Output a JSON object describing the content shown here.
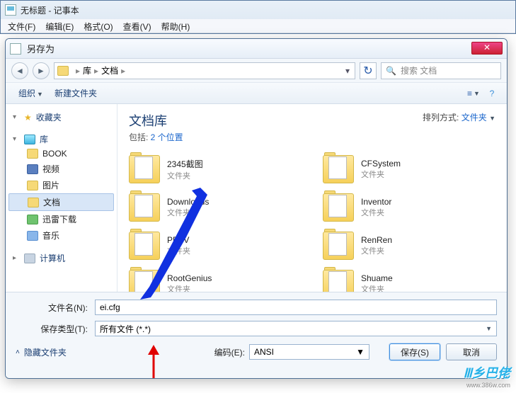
{
  "notepad": {
    "title": "无标题 - 记事本",
    "menu": {
      "file": "文件(F)",
      "edit": "编辑(E)",
      "format": "格式(O)",
      "view": "查看(V)",
      "help": "帮助(H)"
    }
  },
  "dialog": {
    "title": "另存为",
    "close_glyph": "✕",
    "breadcrumb": {
      "root": "库",
      "current": "文档"
    },
    "search_placeholder": "搜索 文档",
    "toolbar": {
      "organize": "组织",
      "new_folder": "新建文件夹"
    },
    "sidebar": {
      "favorites": "收藏夹",
      "libraries": "库",
      "items": [
        {
          "label": "BOOK"
        },
        {
          "label": "视频"
        },
        {
          "label": "图片"
        },
        {
          "label": "文档"
        },
        {
          "label": "迅雷下载"
        },
        {
          "label": "音乐"
        }
      ],
      "computer": "计算机"
    },
    "content": {
      "title": "文档库",
      "include_prefix": "包括: ",
      "include_link": "2 个位置",
      "arrange_label": "排列方式: ",
      "arrange_value": "文件夹",
      "folder_type": "文件夹",
      "folders": [
        {
          "name": "2345截图"
        },
        {
          "name": "CFSystem"
        },
        {
          "name": "Downloads"
        },
        {
          "name": "Inventor"
        },
        {
          "name": "PPTV"
        },
        {
          "name": "RenRen"
        },
        {
          "name": "RootGenius"
        },
        {
          "name": "Shuame"
        }
      ]
    },
    "form": {
      "filename_label": "文件名(N):",
      "filename_value": "ei.cfg",
      "filetype_label": "保存类型(T):",
      "filetype_value": "所有文件 (*.*)",
      "hide_folders": "隐藏文件夹",
      "encoding_label": "编码(E):",
      "encoding_value": "ANSI",
      "save_btn": "保存(S)",
      "cancel_btn": "取消"
    }
  },
  "watermark": {
    "brand": "Ⅲ乡巴佬",
    "url": "www.386w.com"
  }
}
